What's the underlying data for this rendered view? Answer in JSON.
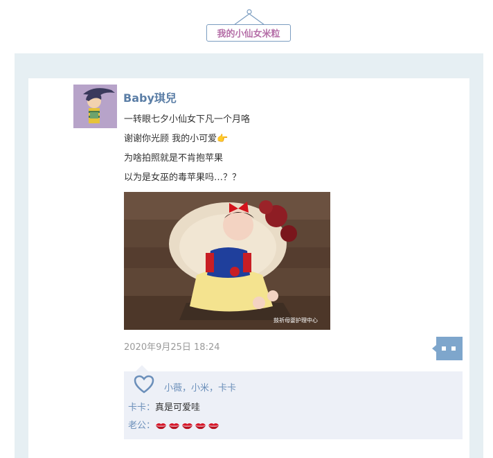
{
  "header": {
    "title": "我的小仙女米粒"
  },
  "post": {
    "author": "Baby琪兒",
    "lines": [
      "一转眼七夕小仙女下凡一个月咯",
      "谢谢你光顾 我的小可爱👉",
      "为啥拍照就是不肯抱苹果",
      "以为是女巫的毒苹果吗…？？"
    ],
    "photo_watermark": "鼓祈母婴护理中心",
    "timestamp": "2020年9月25日 18:24"
  },
  "interactions": {
    "likers": "小薇，小米，卡卡",
    "comments": [
      {
        "user": "卡卡",
        "sep": "：",
        "text": "真是可爱哇"
      },
      {
        "user": "老公",
        "sep": "：",
        "lips_count": 5
      }
    ]
  },
  "colors": {
    "accent": "#5b7ea6",
    "title": "#b56fa8",
    "background": "#e6eff3"
  },
  "icons": {
    "like": "heart-icon",
    "more": "more-icon",
    "lips": "lips-icon"
  }
}
